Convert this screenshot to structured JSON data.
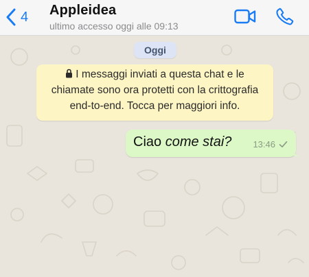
{
  "header": {
    "back_count": "4",
    "contact_name": "Appleidea",
    "contact_status": "ultimo accesso oggi alle 09:13"
  },
  "chat": {
    "date_label": "Oggi",
    "encryption_notice": {
      "line1": "I messaggi inviati a questa chat e le",
      "line2": "chiamate sono ora protetti con la crittografia",
      "line3": "end-to-end. Tocca per maggiori info."
    },
    "messages": [
      {
        "text_plain": "Ciao ",
        "text_italic": "come stai?",
        "time": "13:46",
        "status": "sent"
      }
    ]
  },
  "colors": {
    "accent": "#1a7cf5",
    "bubble_out": "#dcf8c6",
    "notice_bg": "#fdf5c4",
    "date_pill_bg": "#dde4f6",
    "wallpaper": "#e9e4dc"
  },
  "icons": {
    "back": "chevron-left-icon",
    "video": "video-camera-icon",
    "phone": "phone-icon",
    "lock": "lock-icon",
    "tick": "check-icon"
  }
}
